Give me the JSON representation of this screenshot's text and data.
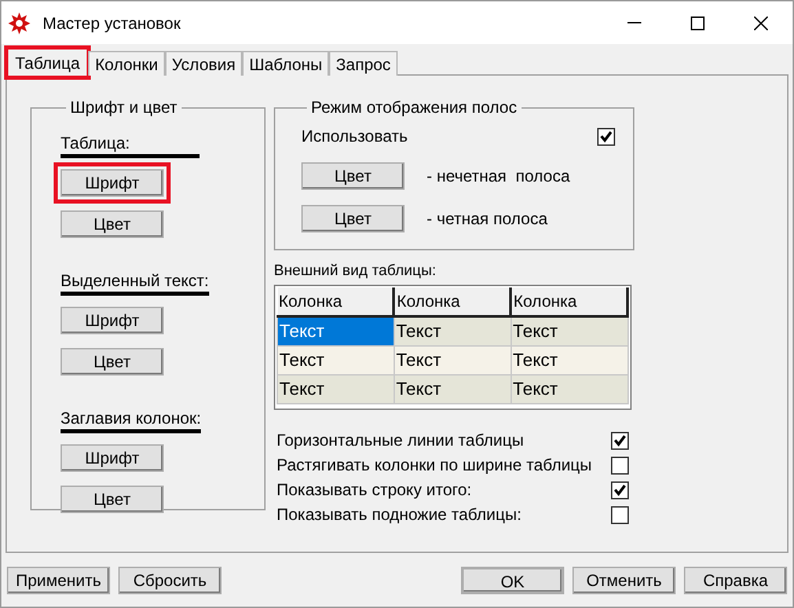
{
  "window": {
    "title": "Мастер установок"
  },
  "tabs": [
    {
      "label": "Таблица",
      "selected": true,
      "highlighted": true
    },
    {
      "label": "Колонки",
      "selected": false,
      "highlighted": false
    },
    {
      "label": "Условия",
      "selected": false,
      "highlighted": false
    },
    {
      "label": "Шаблоны",
      "selected": false,
      "highlighted": false
    },
    {
      "label": "Запрос",
      "selected": false,
      "highlighted": false
    }
  ],
  "font_group": {
    "title": "Шрифт и цвет",
    "sections": [
      {
        "label": "Таблица:",
        "buttons": [
          {
            "label": "Шрифт",
            "highlighted": true
          },
          {
            "label": "Цвет",
            "highlighted": false
          }
        ]
      },
      {
        "label": "Выделенный текст:",
        "buttons": [
          {
            "label": "Шрифт",
            "highlighted": false
          },
          {
            "label": "Цвет",
            "highlighted": false
          }
        ]
      },
      {
        "label": "Заглавия колонок:",
        "buttons": [
          {
            "label": "Шрифт",
            "highlighted": false
          },
          {
            "label": "Цвет",
            "highlighted": false
          }
        ]
      }
    ]
  },
  "stripes": {
    "title": "Режим отображения полос",
    "use": {
      "label": "Использовать",
      "checked": true
    },
    "rows": [
      {
        "button": "Цвет",
        "label": "- нечетная  полоса"
      },
      {
        "button": "Цвет",
        "label": "- четная полоса"
      }
    ]
  },
  "preview": {
    "label": "Внешний вид таблицы:",
    "columns": [
      "Колонка",
      "Колонка",
      "Колонка"
    ],
    "rows": [
      {
        "color": "#e5e5d8",
        "cells": [
          {
            "text": "Текст",
            "selected": true
          },
          {
            "text": "Текст",
            "selected": false
          },
          {
            "text": "Текст",
            "selected": false
          }
        ]
      },
      {
        "color": "#f5f2e8",
        "cells": [
          {
            "text": "Текст",
            "selected": false
          },
          {
            "text": "Текст",
            "selected": false
          },
          {
            "text": "Текст",
            "selected": false
          }
        ]
      },
      {
        "color": "#e5e5d8",
        "cells": [
          {
            "text": "Текст",
            "selected": false
          },
          {
            "text": "Текст",
            "selected": false
          },
          {
            "text": "Текст",
            "selected": false
          }
        ]
      }
    ]
  },
  "options": [
    {
      "label": "Горизонтальные линии таблицы",
      "checked": true
    },
    {
      "label": "Растягивать колонки по ширине таблицы",
      "checked": false
    },
    {
      "label": "Показывать строку итого:",
      "checked": true
    },
    {
      "label": "Показывать подножие таблицы:",
      "checked": false
    }
  ],
  "buttons_left": [
    "Применить",
    "Сбросить"
  ],
  "buttons_right": [
    {
      "label": "OK",
      "default": true
    },
    {
      "label": "Отменить",
      "default": false
    },
    {
      "label": "Справка",
      "default": false
    }
  ]
}
